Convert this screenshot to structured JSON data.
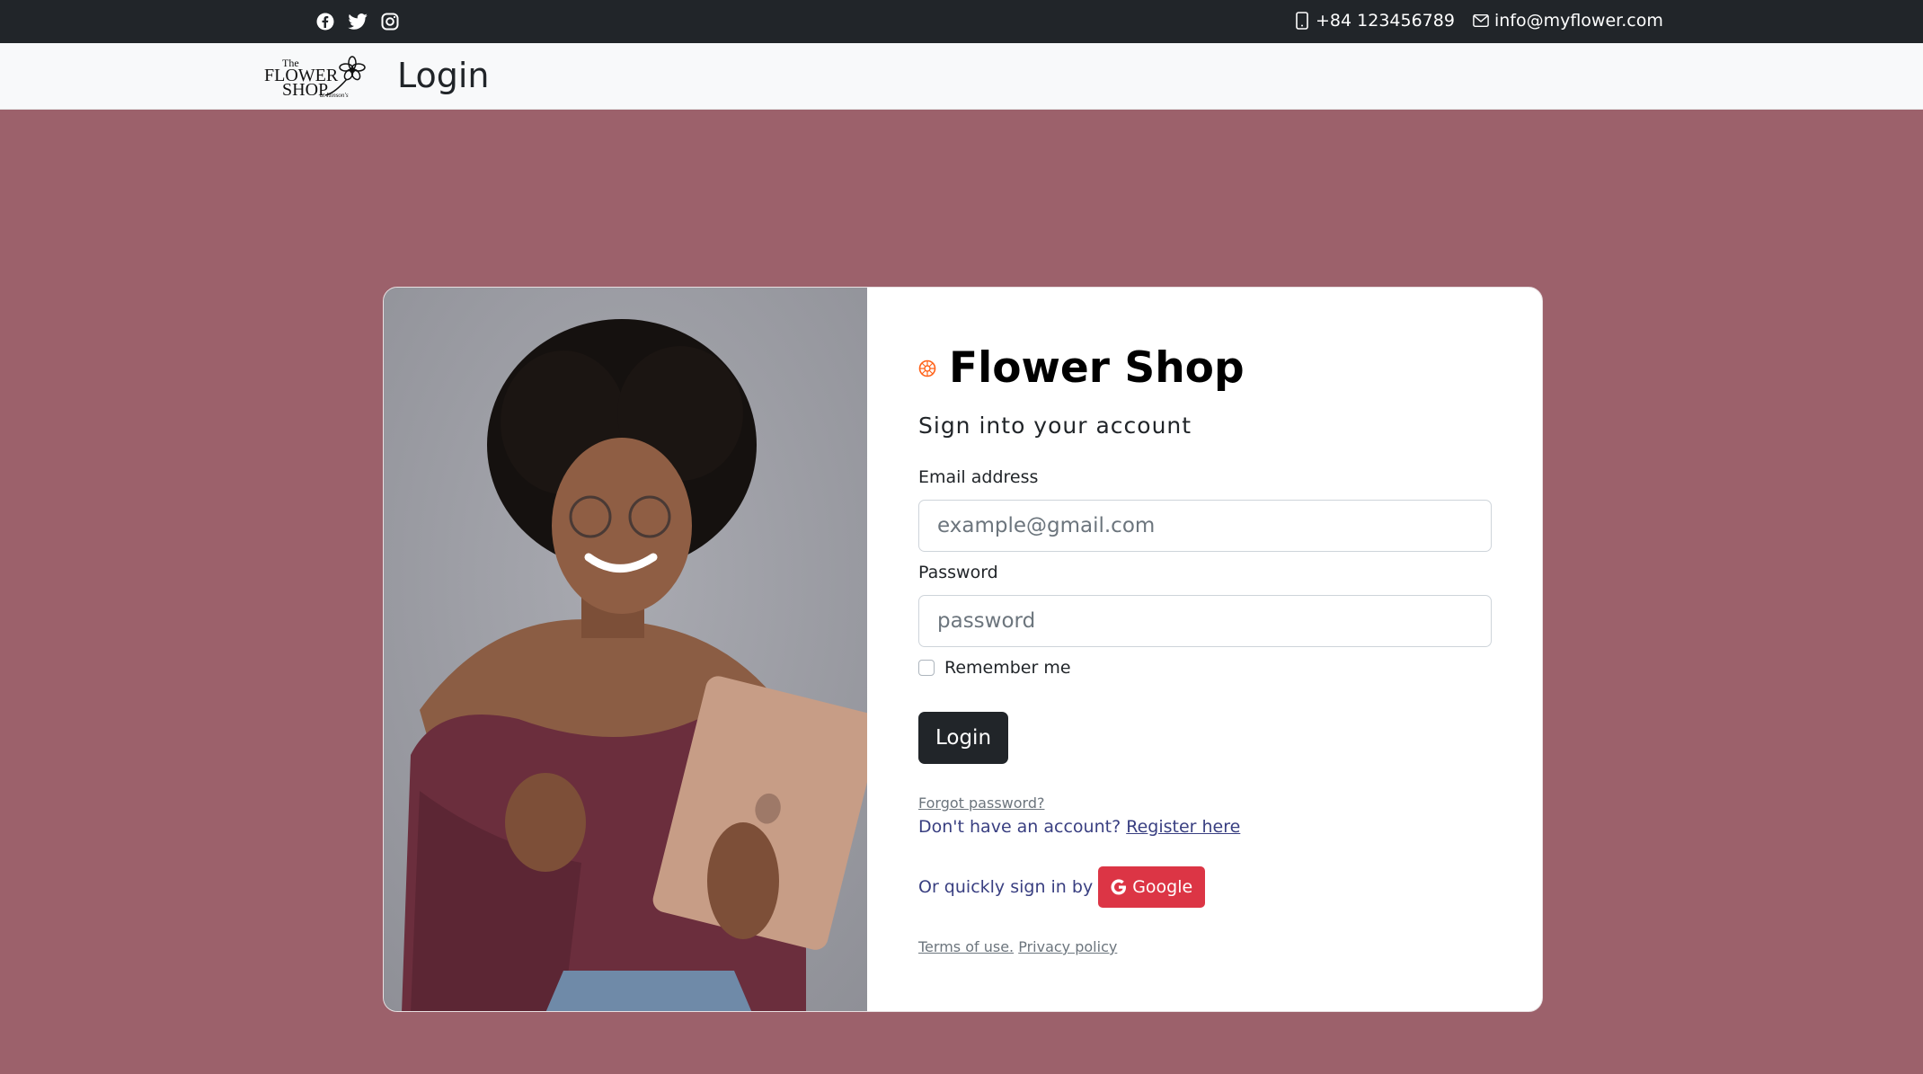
{
  "topbar": {
    "social_icons": [
      "facebook-icon",
      "twitter-icon",
      "instagram-icon"
    ],
    "phone": "+84 123456789",
    "email": "info@myflower.com"
  },
  "navbar": {
    "logo_text_the": "The",
    "logo_text_flower": "FLOWER",
    "logo_text_shop": "SHOP",
    "title": "Login"
  },
  "login": {
    "brand_name": "Flower Shop",
    "subtitle": "Sign into your account",
    "email_label": "Email address",
    "email_placeholder": "example@gmail.com",
    "password_label": "Password",
    "password_placeholder": "password",
    "remember_label": "Remember me",
    "login_button": "Login",
    "forgot_password": "Forgot password?",
    "no_account_text": "Don't have an account?",
    "register_link": "Register here",
    "quick_signin_text": "Or quickly sign in by",
    "google_button": "Google",
    "terms_link": "Terms of use.",
    "privacy_link": "Privacy policy"
  },
  "colors": {
    "background": "#9c616b",
    "topbar": "#212529",
    "login_button": "#212529",
    "google_button": "#dc3545",
    "link": "#393f81",
    "brand_icon": "#ff6219"
  }
}
